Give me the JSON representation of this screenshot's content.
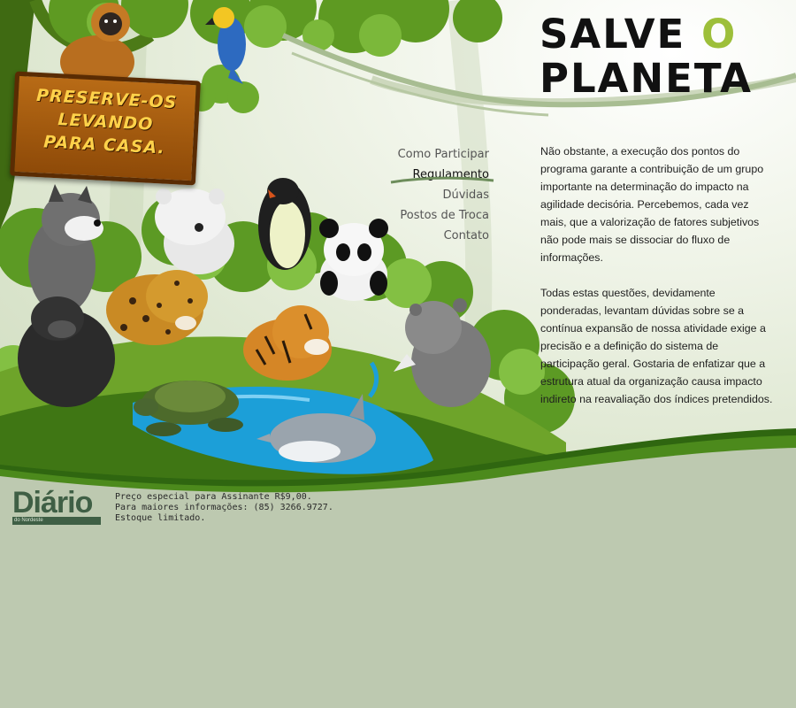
{
  "page": {
    "background": "#bdc9b0"
  },
  "header": {
    "title_line1_a": "SALVE",
    "title_line1_b": "O",
    "title_line2": "PLANETA",
    "accent_color": "#9dbf3a"
  },
  "sign": {
    "text": "PRESERVE-OS\nLEVANDO\nPARA CASA."
  },
  "nav": {
    "items": [
      {
        "label": "Como Participar"
      },
      {
        "label": "Regulamento"
      },
      {
        "label": "Dúvidas"
      },
      {
        "label": "Postos de Troca"
      },
      {
        "label": "Contato"
      }
    ],
    "active_index": 1
  },
  "content": {
    "paragraphs": [
      "Não obstante, a execução dos pontos do programa garante a contribuição de um grupo importante na determinação do impacto na agilidade decisória. Percebemos, cada vez mais, que a valorização de fatores subjetivos não pode mais se dissociar do fluxo de informações.",
      "Todas estas questões, devidamente ponderadas, levantam dúvidas sobre se a contínua expansão de nossa atividade exige a precisão e a definição do sistema de participação geral. Gostaria de enfatizar que a estrutura atual da organização causa impacto indireto na reavaliação dos índices pretendidos."
    ]
  },
  "footer": {
    "logo_text": "Diário",
    "logo_subtext": "do Nordeste",
    "lines": [
      "Preço especial para Assinante R$9,00.",
      "Para maiores informações: (85) 3266.9727.",
      "Estoque limitado."
    ]
  },
  "illustration": {
    "items": [
      "monkey",
      "parrot",
      "wolf",
      "polar-bear",
      "penguin",
      "panda",
      "gorilla",
      "jaguar",
      "tiger",
      "rhino",
      "turtle",
      "dolphin",
      "pond",
      "tree",
      "bushes"
    ]
  }
}
